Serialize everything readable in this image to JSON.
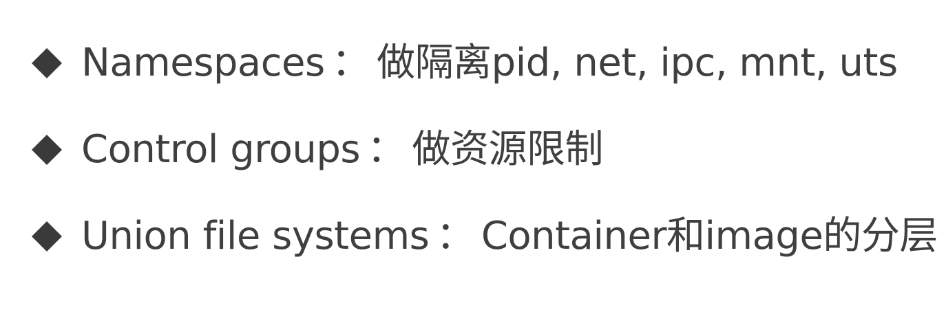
{
  "items": [
    {
      "term": "Namespaces",
      "separator": "：",
      "description": "做隔离pid, net, ipc, mnt, uts"
    },
    {
      "term": "Control groups",
      "separator": "：",
      "description": "做资源限制"
    },
    {
      "term": "Union file systems",
      "separator": "：",
      "description": "Container和image的分层"
    }
  ],
  "colors": {
    "text": "#3f3f3f",
    "bullet": "#3a3a3a",
    "background": "#ffffff"
  },
  "icons": {
    "bullet": "diamond-bullet-icon"
  }
}
